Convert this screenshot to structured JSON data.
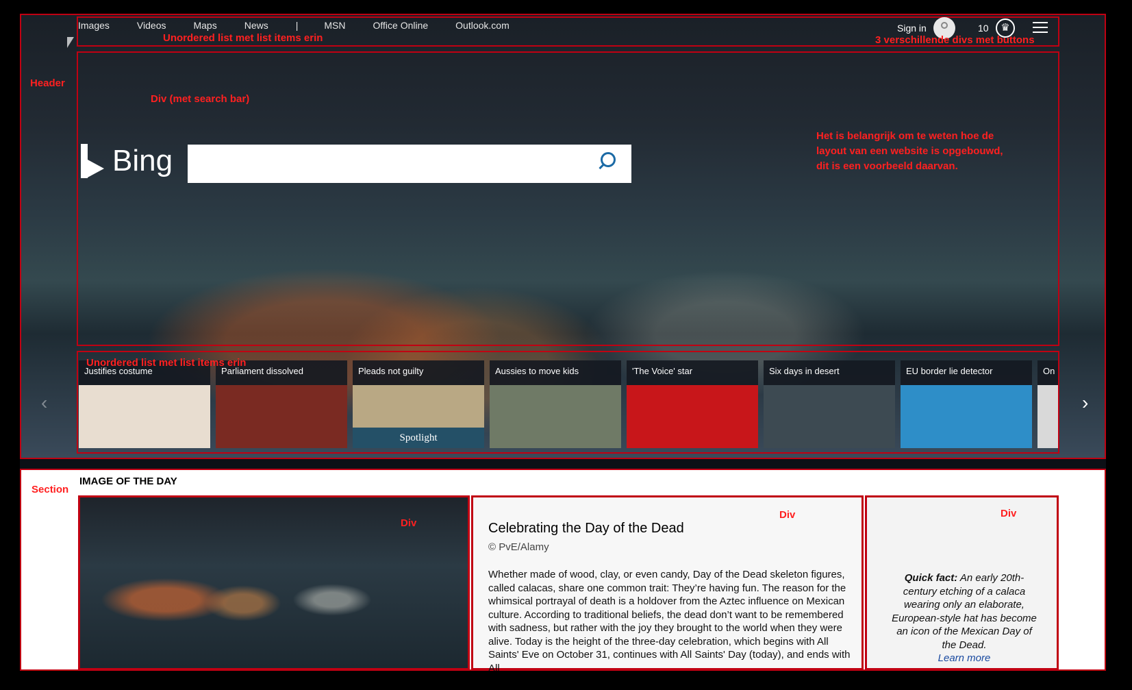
{
  "nav": {
    "items": [
      "Images",
      "Videos",
      "Maps",
      "News",
      "|",
      "MSN",
      "Office Online",
      "Outlook.com"
    ]
  },
  "account": {
    "sign_in": "Sign in",
    "points": "10"
  },
  "search": {
    "brand": "Bing",
    "placeholder": ""
  },
  "annotations": {
    "header": "Header",
    "nav_list": "Unordered list met list items erin",
    "buttons": "3 verschillende divs met buttons",
    "search_div": "Div (met search bar)",
    "note_lines": [
      "Het is belangrijk om te weten hoe de",
      "layout van een website is opgebouwd,",
      "dit is een voorbeeld daarvan."
    ],
    "news_list": "Unordered list met list items erin",
    "section": "Section",
    "div": "Div"
  },
  "news": [
    {
      "title": "Justifies costume",
      "color": "#e8ddd0"
    },
    {
      "title": "Parliament dissolved",
      "color": "#7a2a22"
    },
    {
      "title": "Pleads not guilty",
      "color": "#b9a884",
      "spotlight": "Spotlight"
    },
    {
      "title": "Aussies to move kids",
      "color": "#6f7a66"
    },
    {
      "title": "'The Voice' star",
      "color": "#c8161a"
    },
    {
      "title": "Six days in desert",
      "color": "#3d4a52"
    },
    {
      "title": "EU border lie detector",
      "color": "#2e8ec8"
    },
    {
      "title": "On",
      "color": "#d9d9d9"
    }
  ],
  "section": {
    "title": "IMAGE OF THE DAY",
    "article_title": "Celebrating the Day of the Dead",
    "credit": "© PvE/Alamy",
    "body": "Whether made of wood, clay, or even candy, Day of the Dead skeleton figures, called calacas, share one common trait: They’re having fun. The reason for the whimsical portrayal of death is a holdover from the Aztec influence on Mexican culture. According to traditional beliefs, the dead don’t want to be remembered with sadness, but rather with the joy they brought to the world when they were alive. Today is the height of the three-day celebration, which begins with All Saints' Eve on October 31, continues with All Saints' Day (today), and ends with All",
    "quick_fact_label": "Quick fact:",
    "quick_fact": " An early 20th-century etching of a calaca wearing only an elaborate, European-style hat has become an icon of the Mexican Day of the Dead.",
    "learn_more": "Learn more"
  }
}
